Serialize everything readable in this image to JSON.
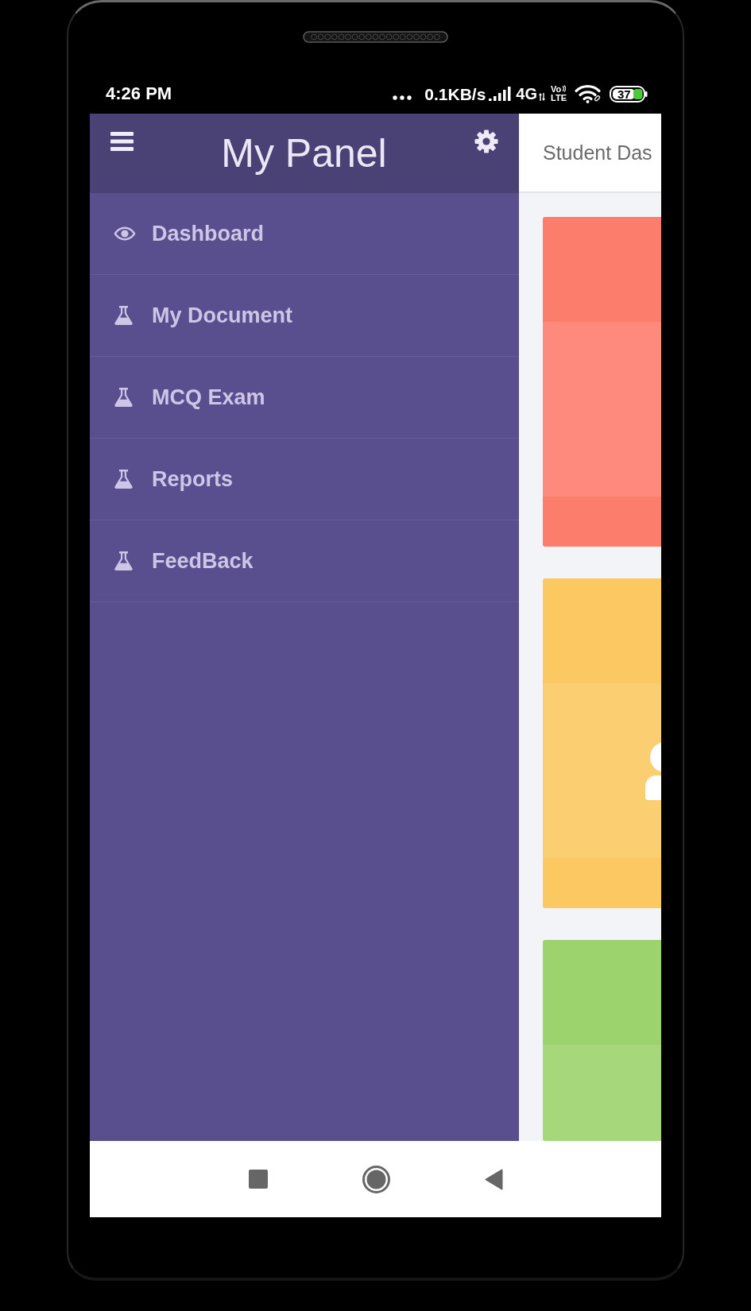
{
  "status_bar": {
    "time": "4:26 PM",
    "speed": "0.1KB/s",
    "network": "4G",
    "volte": [
      "Vo",
      "LTE"
    ],
    "battery": "37"
  },
  "drawer": {
    "title": "My Panel",
    "items": [
      {
        "label": "Dashboard",
        "kind": "eye"
      },
      {
        "label": "My Document",
        "kind": "flask"
      },
      {
        "label": "MCQ Exam",
        "kind": "flask"
      },
      {
        "label": "Reports",
        "kind": "flask"
      },
      {
        "label": "FeedBack",
        "kind": "flask"
      }
    ]
  },
  "page": {
    "title": "Student Das",
    "cards": [
      {
        "color": "#fd7d6d",
        "icon_shown": false
      },
      {
        "color": "#fcc862",
        "icon_shown": true
      },
      {
        "color": "#9dd36c",
        "icon_shown": false
      }
    ]
  }
}
